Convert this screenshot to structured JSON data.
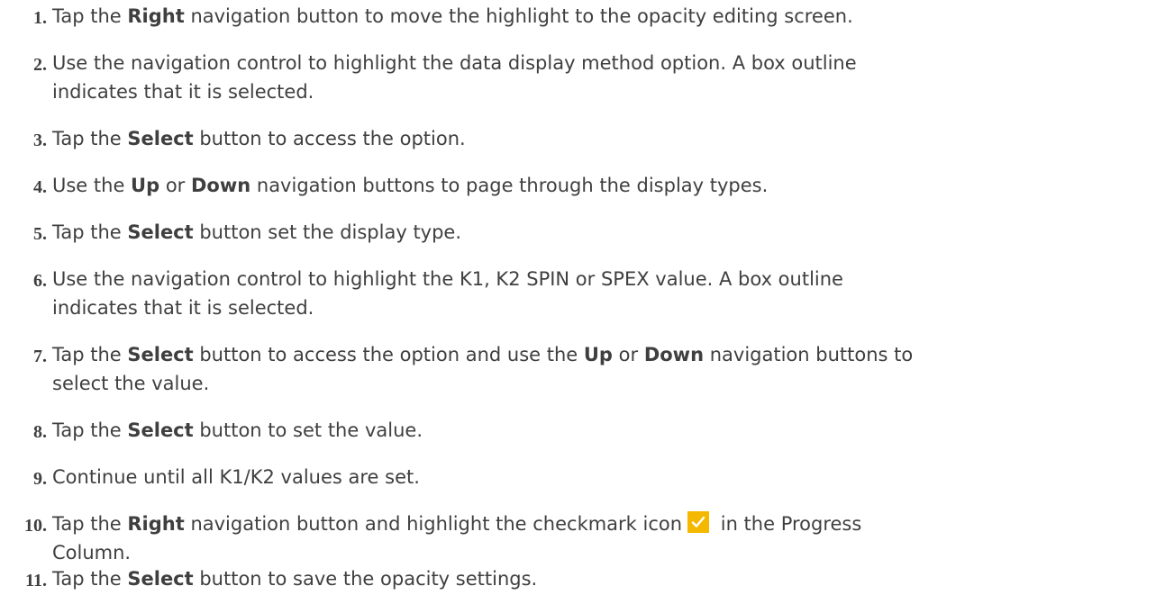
{
  "steps": [
    {
      "number": "1.",
      "parts": [
        "Tap the ",
        "Right",
        " navigation button to move the highlight to the opacity editing screen."
      ]
    },
    {
      "number": "2.",
      "line1": "Use the navigation control to highlight the data display method option. A box outline",
      "line2": "indicates that it is selected."
    },
    {
      "number": "3.",
      "parts": [
        "Tap the ",
        "Select",
        " button to access the option."
      ]
    },
    {
      "number": "4.",
      "parts": [
        "Use the ",
        "Up",
        " or ",
        "Down",
        " navigation buttons to page through the display types."
      ]
    },
    {
      "number": "5.",
      "parts": [
        "Tap the ",
        "Select",
        " button set the display type."
      ]
    },
    {
      "number": "6.",
      "line1": "Use the navigation control to highlight the K1, K2 SPIN or SPEX value. A box outline",
      "line2": "indicates that it is selected."
    },
    {
      "number": "7.",
      "parts": [
        "Tap the ",
        "Select",
        " button to access the option and use the ",
        "Up",
        " or ",
        "Down",
        " navigation buttons to"
      ],
      "line2": "select the value."
    },
    {
      "number": "8.",
      "parts": [
        "Tap the ",
        "Select",
        " button to set the value."
      ]
    },
    {
      "number": "9.",
      "text": "Continue until all K1/K2 values are set."
    },
    {
      "number": "10.",
      "parts": [
        "Tap the ",
        "Right",
        " navigation button and highlight the checkmark icon",
        " in the Progress"
      ],
      "line2": "Column.",
      "icon": "checkmark-icon",
      "icon_color": "#f5b800"
    },
    {
      "number": "11.",
      "parts": [
        "Tap the ",
        "Select",
        " button to save the opacity settings."
      ]
    }
  ]
}
